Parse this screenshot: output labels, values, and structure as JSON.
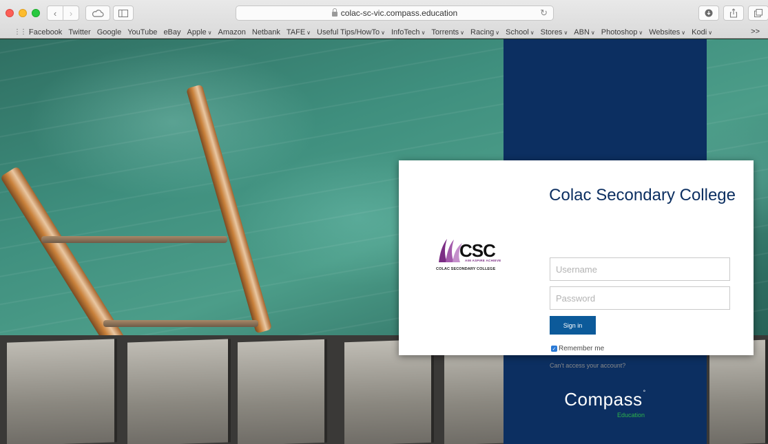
{
  "browser": {
    "url": "colac-sc-vic.compass.education",
    "bookmarks": [
      {
        "label": "Facebook",
        "dropdown": false
      },
      {
        "label": "Twitter",
        "dropdown": false
      },
      {
        "label": "Google",
        "dropdown": false
      },
      {
        "label": "YouTube",
        "dropdown": false
      },
      {
        "label": "eBay",
        "dropdown": false
      },
      {
        "label": "Apple",
        "dropdown": true
      },
      {
        "label": "Amazon",
        "dropdown": false
      },
      {
        "label": "Netbank",
        "dropdown": false
      },
      {
        "label": "TAFE",
        "dropdown": true
      },
      {
        "label": "Useful Tips/HowTo",
        "dropdown": true
      },
      {
        "label": "InfoTech",
        "dropdown": true
      },
      {
        "label": "Torrents",
        "dropdown": true
      },
      {
        "label": "Racing",
        "dropdown": true
      },
      {
        "label": "School",
        "dropdown": true
      },
      {
        "label": "Stores",
        "dropdown": true
      },
      {
        "label": "ABN",
        "dropdown": true
      },
      {
        "label": "Photoshop",
        "dropdown": true
      },
      {
        "label": "Websites",
        "dropdown": true
      },
      {
        "label": "Kodi",
        "dropdown": true
      }
    ],
    "bookmarks_overflow": ">>"
  },
  "login": {
    "college_name": "Colac Secondary College",
    "logo_text": "CSC",
    "logo_tagline": "AIM ASPIRE ACHIEVE",
    "logo_full_name": "COLAC SECONDARY COLLEGE",
    "username_placeholder": "Username",
    "password_placeholder": "Password",
    "signin_label": "Sign in",
    "remember_label": "Remember me",
    "remember_checked": true,
    "cant_access_label": "Can't access your account?"
  },
  "brand": {
    "name": "Compass",
    "sub": "Education",
    "band_color": "#0c2f61",
    "accent_green": "#2db34a"
  }
}
